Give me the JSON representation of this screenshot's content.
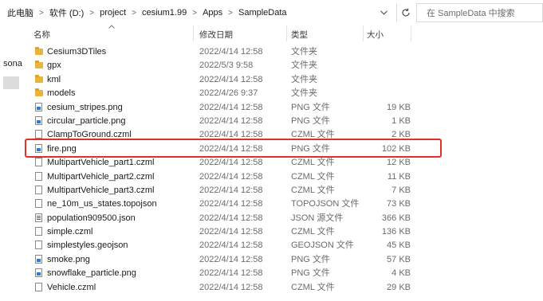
{
  "address": {
    "path": [
      "此电脑",
      "软件 (D:)",
      "project",
      "cesium1.99",
      "Apps",
      "SampleData"
    ],
    "separator": ">",
    "dropdown_icon": "chevron-down-icon",
    "refresh_icon": "refresh-icon"
  },
  "search": {
    "placeholder": "在 SampleData 中搜索"
  },
  "nav": {
    "partial_label": "sona"
  },
  "columns": {
    "name": "名称",
    "date": "修改日期",
    "type": "类型",
    "size": "大小"
  },
  "files": [
    {
      "name": "Cesium3DTiles",
      "date": "2022/4/14 12:58",
      "type": "文件夹",
      "size": "",
      "icon": "folder"
    },
    {
      "name": "gpx",
      "date": "2022/5/3 9:58",
      "type": "文件夹",
      "size": "",
      "icon": "folder"
    },
    {
      "name": "kml",
      "date": "2022/4/14 12:58",
      "type": "文件夹",
      "size": "",
      "icon": "folder"
    },
    {
      "name": "models",
      "date": "2022/4/26 9:37",
      "type": "文件夹",
      "size": "",
      "icon": "folder"
    },
    {
      "name": "cesium_stripes.png",
      "date": "2022/4/14 12:58",
      "type": "PNG 文件",
      "size": "19 KB",
      "icon": "image"
    },
    {
      "name": "circular_particle.png",
      "date": "2022/4/14 12:58",
      "type": "PNG 文件",
      "size": "1 KB",
      "icon": "image"
    },
    {
      "name": "ClampToGround.czml",
      "date": "2022/4/14 12:58",
      "type": "CZML 文件",
      "size": "2 KB",
      "icon": "doc"
    },
    {
      "name": "fire.png",
      "date": "2022/4/14 12:58",
      "type": "PNG 文件",
      "size": "102 KB",
      "icon": "image"
    },
    {
      "name": "MultipartVehicle_part1.czml",
      "date": "2022/4/14 12:58",
      "type": "CZML 文件",
      "size": "12 KB",
      "icon": "doc"
    },
    {
      "name": "MultipartVehicle_part2.czml",
      "date": "2022/4/14 12:58",
      "type": "CZML 文件",
      "size": "11 KB",
      "icon": "doc"
    },
    {
      "name": "MultipartVehicle_part3.czml",
      "date": "2022/4/14 12:58",
      "type": "CZML 文件",
      "size": "7 KB",
      "icon": "doc"
    },
    {
      "name": "ne_10m_us_states.topojson",
      "date": "2022/4/14 12:58",
      "type": "TOPOJSON 文件",
      "size": "73 KB",
      "icon": "doc"
    },
    {
      "name": "population909500.json",
      "date": "2022/4/14 12:58",
      "type": "JSON 源文件",
      "size": "366 KB",
      "icon": "json"
    },
    {
      "name": "simple.czml",
      "date": "2022/4/14 12:58",
      "type": "CZML 文件",
      "size": "136 KB",
      "icon": "doc"
    },
    {
      "name": "simplestyles.geojson",
      "date": "2022/4/14 12:58",
      "type": "GEOJSON 文件",
      "size": "45 KB",
      "icon": "doc"
    },
    {
      "name": "smoke.png",
      "date": "2022/4/14 12:58",
      "type": "PNG 文件",
      "size": "57 KB",
      "icon": "image"
    },
    {
      "name": "snowflake_particle.png",
      "date": "2022/4/14 12:58",
      "type": "PNG 文件",
      "size": "4 KB",
      "icon": "image"
    },
    {
      "name": "Vehicle.czml",
      "date": "2022/4/14 12:58",
      "type": "CZML 文件",
      "size": "29 KB",
      "icon": "doc"
    }
  ],
  "highlighted_file": "fire.png",
  "colors": {
    "highlight_border": "#e0302a",
    "folder": "#e8b53c",
    "image_icon": "#2e7bd6"
  }
}
